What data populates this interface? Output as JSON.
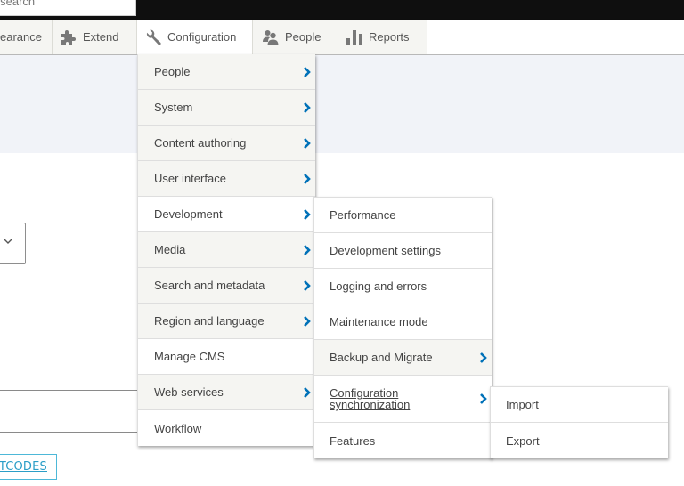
{
  "toolbar": {
    "quick_search_placeholder": "k search"
  },
  "admin_menu": {
    "items": [
      {
        "label": "earance",
        "icon": "appearance-icon"
      },
      {
        "label": "Extend",
        "icon": "puzzle-icon"
      },
      {
        "label": "Configuration",
        "icon": "wrench-icon",
        "active": true
      },
      {
        "label": "People",
        "icon": "people-icon"
      },
      {
        "label": "Reports",
        "icon": "bar-chart-icon"
      }
    ]
  },
  "configuration_menu": {
    "items": [
      {
        "label": "People",
        "has_submenu": true
      },
      {
        "label": "System",
        "has_submenu": true
      },
      {
        "label": "Content authoring",
        "has_submenu": true
      },
      {
        "label": "User interface",
        "has_submenu": true
      },
      {
        "label": "Development",
        "has_submenu": true,
        "open": true
      },
      {
        "label": "Media",
        "has_submenu": true
      },
      {
        "label": "Search and metadata",
        "has_submenu": true
      },
      {
        "label": "Region and language",
        "has_submenu": true
      },
      {
        "label": "Manage CMS",
        "has_submenu": false
      },
      {
        "label": "Web services",
        "has_submenu": true
      },
      {
        "label": "Workflow",
        "has_submenu": false
      }
    ]
  },
  "development_menu": {
    "items": [
      {
        "label": "Performance",
        "has_submenu": false
      },
      {
        "label": "Development settings",
        "has_submenu": false
      },
      {
        "label": "Logging and errors",
        "has_submenu": false
      },
      {
        "label": "Maintenance mode",
        "has_submenu": false
      },
      {
        "label": "Backup and Migrate",
        "has_submenu": true
      },
      {
        "label": "Configuration synchronization",
        "has_submenu": true,
        "open": true,
        "hovered": true
      },
      {
        "label": "Features",
        "has_submenu": false
      }
    ]
  },
  "config_sync_menu": {
    "items": [
      {
        "label": "Import"
      },
      {
        "label": "Export"
      }
    ]
  },
  "page": {
    "shortcodes_button": "RTCODES"
  },
  "colors": {
    "chevron": "#0071b8",
    "menu_alt_bg": "#f5f5f2",
    "header_band": "#f1f3f8",
    "topbar": "#0f0f0f",
    "link_button": "#2b9ec7"
  }
}
